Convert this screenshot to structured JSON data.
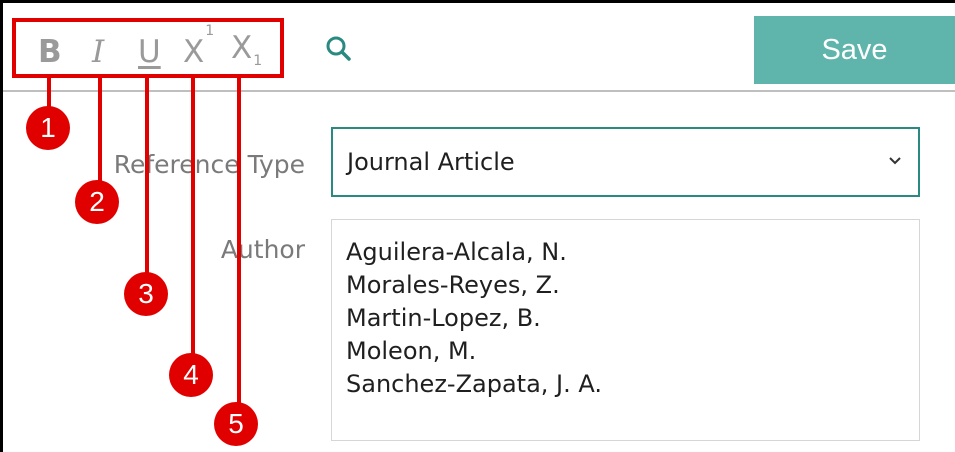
{
  "toolbar": {
    "bold_label": "B",
    "italic_label": "I",
    "underline_label": "U",
    "superscript_base": "X",
    "superscript_mark": "1",
    "subscript_base": "X",
    "subscript_mark": "1",
    "search_icon": "search-icon",
    "save_label": "Save"
  },
  "form": {
    "reference_type_label": "Reference Type",
    "reference_type_value": "Journal Article",
    "author_label": "Author",
    "authors": [
      "Aguilera-Alcala, N.",
      "Morales-Reyes, Z.",
      "Martin-Lopez, B.",
      "Moleon, M.",
      "Sanchez-Zapata, J. A."
    ]
  },
  "annotations": {
    "numbers": [
      "1",
      "2",
      "3",
      "4",
      "5"
    ],
    "highlight_color": "#e10000"
  },
  "colors": {
    "accent": "#5fb5ac",
    "focus_border": "#2a8a82",
    "icon_gray": "#9a9a9a"
  }
}
